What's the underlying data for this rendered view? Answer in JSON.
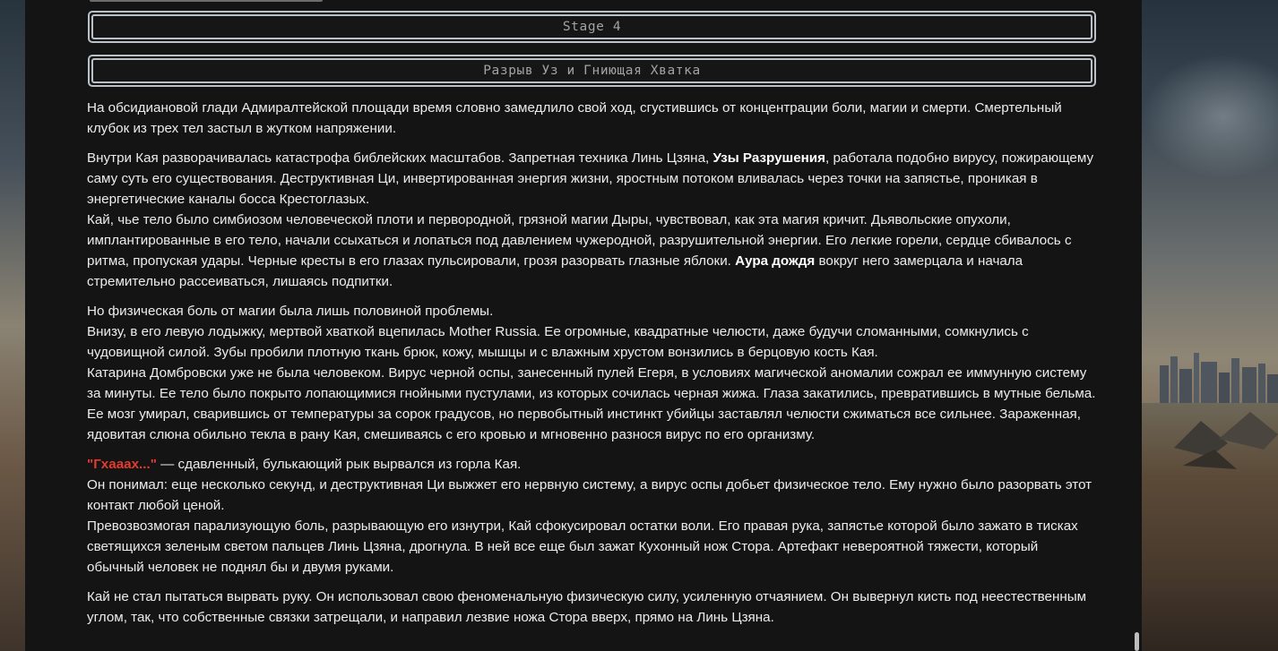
{
  "stage": {
    "label": "Stage 4",
    "chapter_title": "Разрыв Уз и Гниющая Хватка"
  },
  "story": {
    "p1": "На обсидиановой глади Адмиралтейской площади время словно замедлило свой ход, сгустившись от концентрации боли, магии и смерти. Смертельный клубок из трех тел застыл в жутком напряжении.",
    "p2a_pre": "Внутри Кая разворачивалась катастрофа библейских масштабов. Запретная техника Линь Цзяна, ",
    "p2a_bold": "Узы Разрушения",
    "p2a_post": ", работала подобно вирусу, пожирающему саму суть его существования. Деструктивная Ци, инвертированная энергия жизни, яростным потоком вливалась через точки на запястье, проникая в энергетические каналы босса Крестоглазых.",
    "p2b_pre": "Кай, чье тело было симбиозом человеческой плоти и первородной, грязной магии Дыры, чувствовал, как эта магия кричит. Дьявольские опухоли, имплантированные в его тело, начали ссыхаться и лопаться под давлением чужеродной, разрушительной энергии. Его легкие горели, сердце сбивалось с ритма, пропуская удары. Черные кресты в его глазах пульсировали, грозя разорвать глазные яблоки. ",
    "p2b_bold": "Аура дождя",
    "p2b_post": " вокруг него замерцала и начала стремительно рассеиваться, лишаясь подпитки.",
    "p3a": "Но физическая боль от магии была лишь половиной проблемы.",
    "p3b": "Внизу, в его левую лодыжку, мертвой хваткой вцепилась Mother Russia. Ее огромные, квадратные челюсти, даже будучи сломанными, сомкнулись с чудовищной силой. Зубы пробили плотную ткань брюк, кожу, мышцы и с влажным хрустом вонзились в берцовую кость Кая.",
    "p3c": "Катарина Домбровски уже не была человеком. Вирус черной оспы, занесенный пулей Егеря, в условиях магической аномалии сожрал ее иммунную систему за минуты. Ее тело было покрыто лопающимися гнойными пустулами, из которых сочилась черная жижа. Глаза закатились, превратившись в мутные бельма. Ее мозг умирал, сварившись от температуры за сорок градусов, но первобытный инстинкт убийцы заставлял челюсти сжиматься все сильнее. Зараженная, ядовитая слюна обильно текла в рану Кая, смешиваясь с его кровью и мгновенно разнося вирус по его организму.",
    "p4_shout": "\"Гхааах...\"",
    "p4a_post": " — сдавленный, булькающий рык вырвался из горла Кая.",
    "p4b": "Он понимал: еще несколько секунд, и деструктивная Ци выжжет его нервную систему, а вирус оспы добьет физическое тело. Ему нужно было разорвать этот контакт любой ценой.",
    "p4c": "Превозвозмогая парализующую боль, разрывающую его изнутри, Кай сфокусировал остатки воли. Его правая рука, запястье которой было зажато в тисках светящихся зеленым светом пальцев Линь Цзяна, дрогнула. В ней все еще был зажат Кухонный нож Стора. Артефакт невероятной тяжести, который обычный человек не поднял бы и двумя руками.",
    "p5": "Кай не стал пытаться вырвать руку. Он использовал свою феноменальную физическую силу, усиленную отчаянием. Он вывернул кисть под неестественным углом, так, что собственные связки затрещали, и направил лезвие ножа Стора вверх, прямо на Линь Цзяна."
  },
  "colors": {
    "panel_bg": "#141414",
    "text": "#ececec",
    "shout": "#e63a2e",
    "box_border": "#b9c0c7"
  }
}
